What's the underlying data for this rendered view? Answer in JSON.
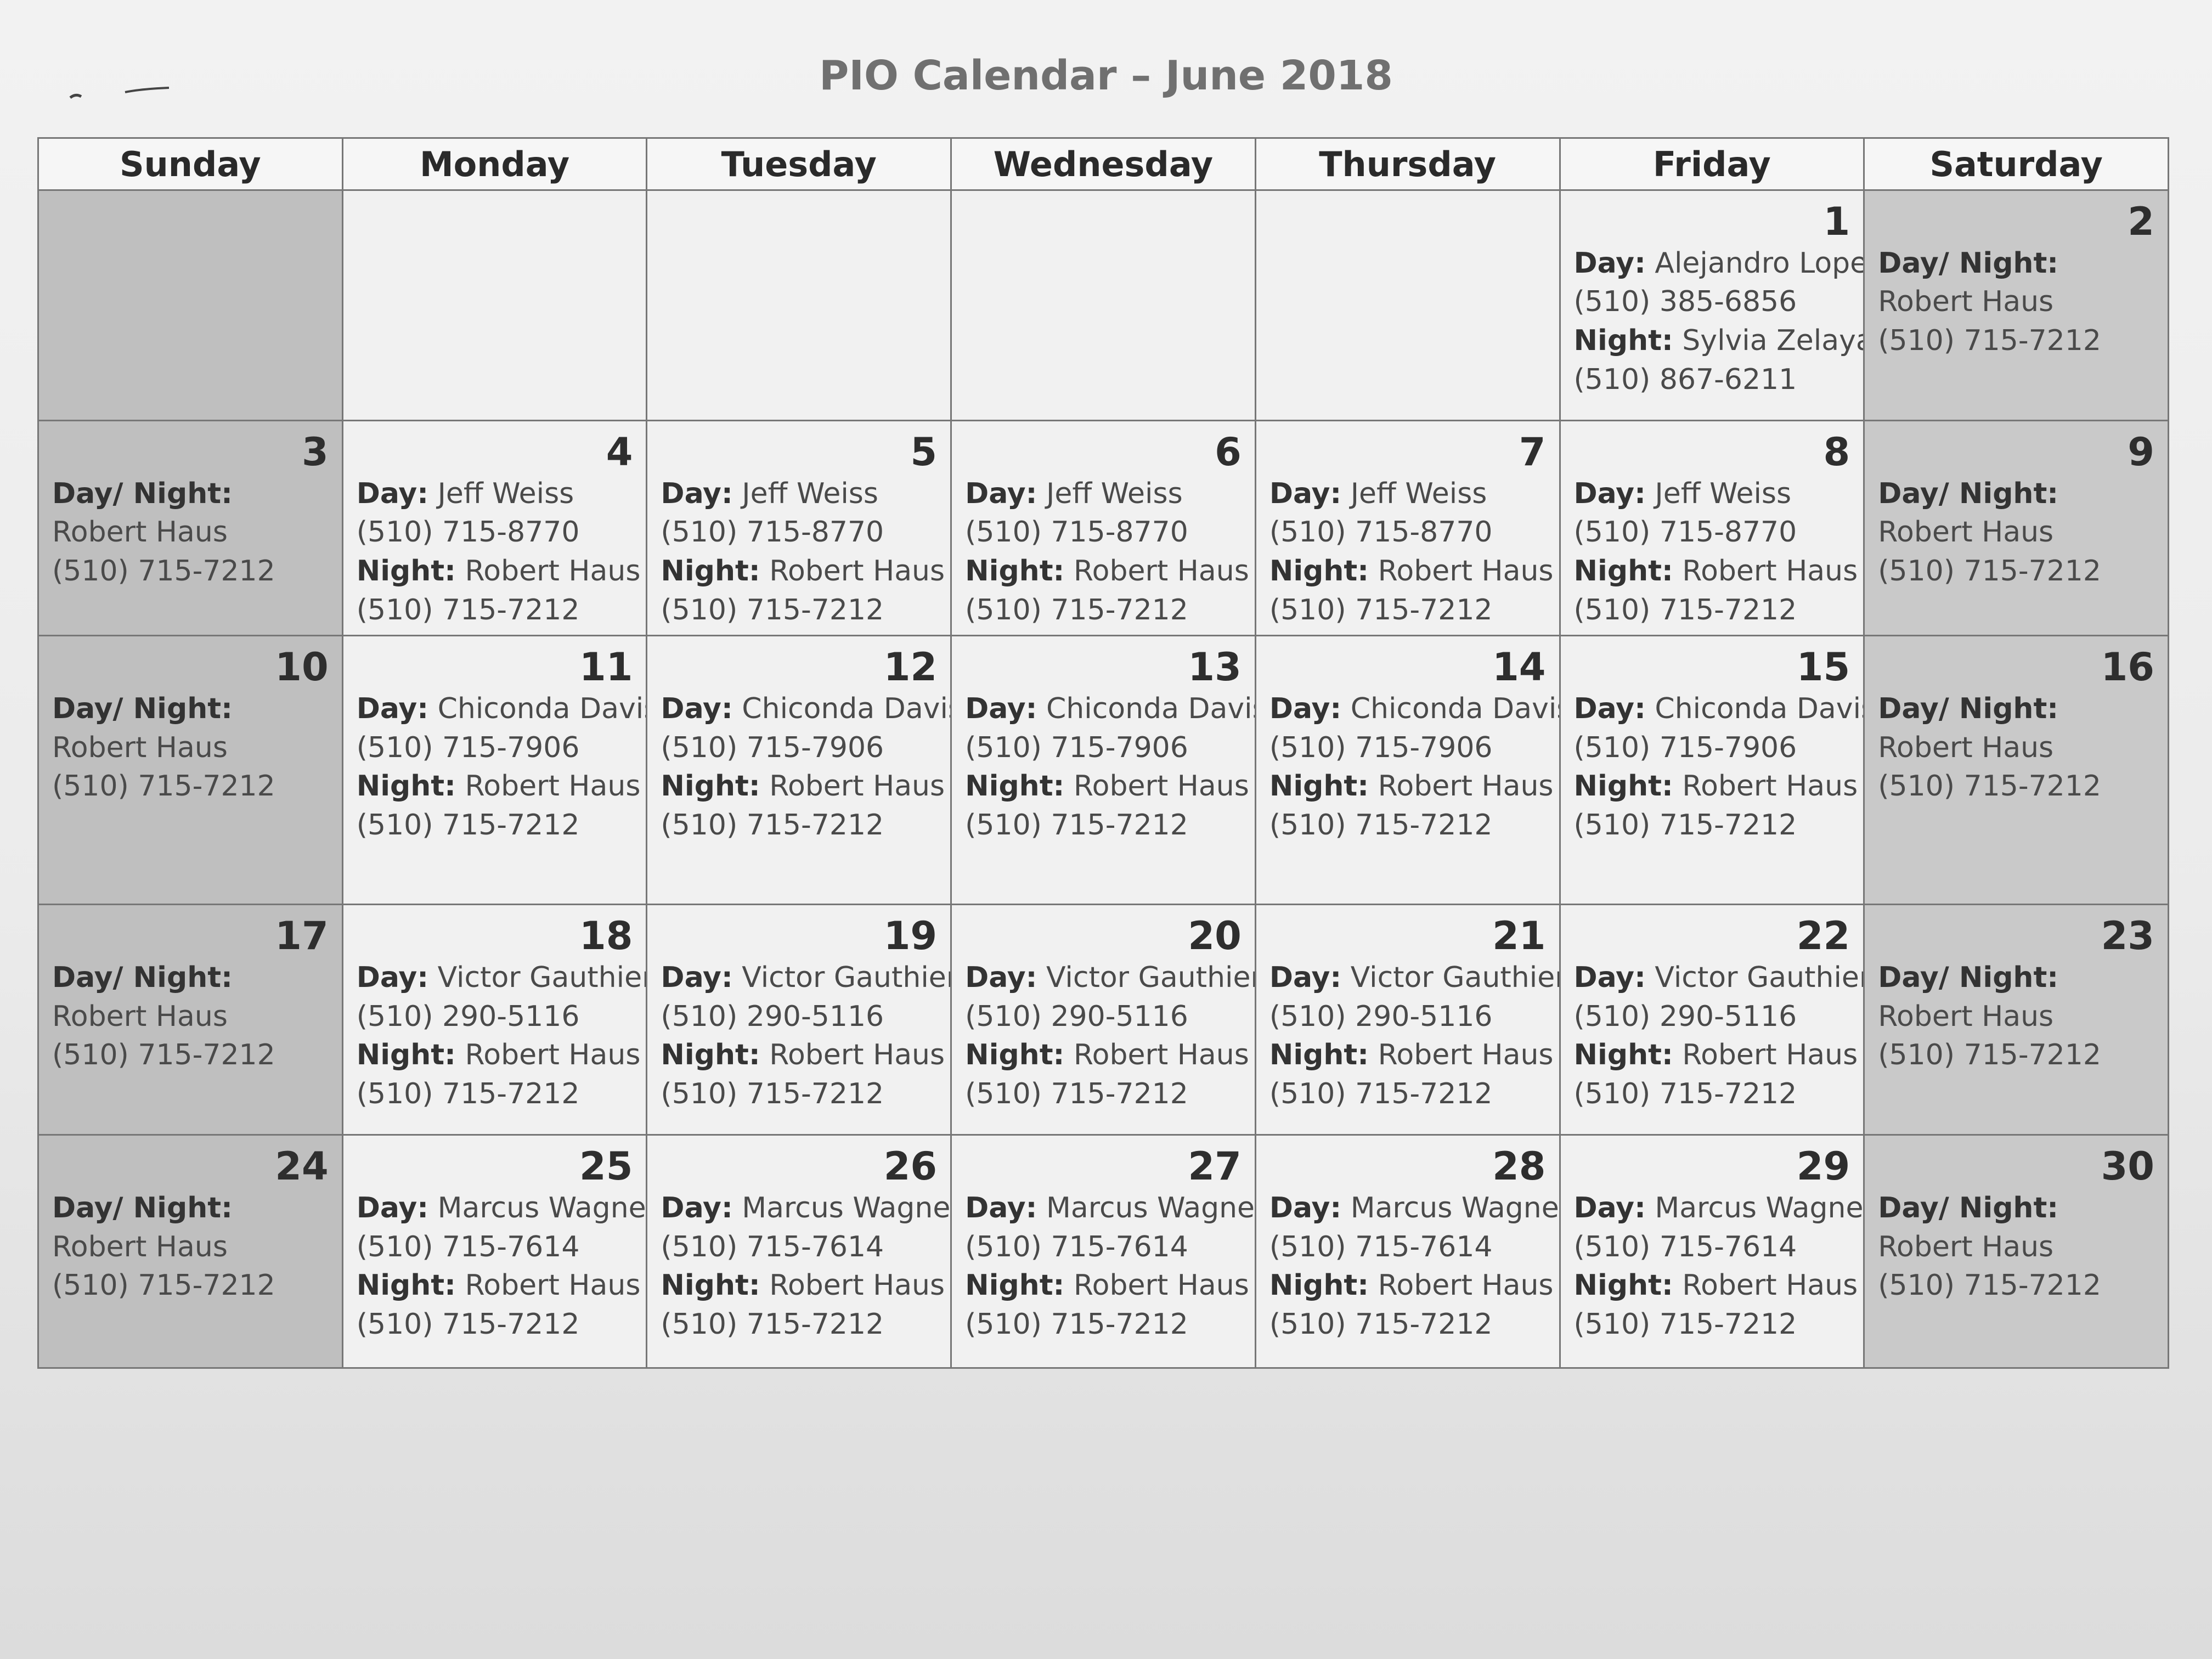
{
  "title": "PIO Calendar – June 2018",
  "weekdays": [
    "Sunday",
    "Monday",
    "Tuesday",
    "Wednesday",
    "Thursday",
    "Friday",
    "Saturday"
  ],
  "labels": {
    "day": "Day:",
    "night": "Night:",
    "daynight": "Day/ Night:"
  },
  "weeks": [
    [
      {
        "date": "",
        "type": "blank"
      },
      {
        "date": "",
        "type": "blank"
      },
      {
        "date": "",
        "type": "blank"
      },
      {
        "date": "",
        "type": "blank"
      },
      {
        "date": "",
        "type": "blank"
      },
      {
        "date": "1",
        "type": "split",
        "day_name": "Alejandro Lopez",
        "day_phone": "(510) 385-6856",
        "night_name": "Sylvia Zelaya",
        "night_phone": "(510) 867-6211"
      },
      {
        "date": "2",
        "type": "combined",
        "name": "Robert Haus",
        "phone": "(510) 715-7212"
      }
    ],
    [
      {
        "date": "3",
        "type": "combined",
        "name": "Robert Haus",
        "phone": "(510) 715-7212"
      },
      {
        "date": "4",
        "type": "split",
        "day_name": "Jeff Weiss",
        "day_phone": "(510) 715-8770",
        "night_name": "Robert Haus",
        "night_phone": "(510) 715-7212"
      },
      {
        "date": "5",
        "type": "split",
        "day_name": "Jeff Weiss",
        "day_phone": "(510) 715-8770",
        "night_name": "Robert Haus",
        "night_phone": "(510) 715-7212"
      },
      {
        "date": "6",
        "type": "split",
        "day_name": "Jeff Weiss",
        "day_phone": "(510) 715-8770",
        "night_name": "Robert Haus",
        "night_phone": "(510) 715-7212"
      },
      {
        "date": "7",
        "type": "split",
        "day_name": "Jeff Weiss",
        "day_phone": "(510) 715-8770",
        "night_name": "Robert Haus",
        "night_phone": "(510) 715-7212"
      },
      {
        "date": "8",
        "type": "split",
        "day_name": "Jeff Weiss",
        "day_phone": "(510) 715-8770",
        "night_name": "Robert Haus",
        "night_phone": "(510) 715-7212"
      },
      {
        "date": "9",
        "type": "combined",
        "name": "Robert Haus",
        "phone": "(510) 715-7212"
      }
    ],
    [
      {
        "date": "10",
        "type": "combined",
        "name": "Robert Haus",
        "phone": "(510) 715-7212"
      },
      {
        "date": "11",
        "type": "split",
        "day_name": "Chiconda Davis",
        "day_phone": "(510) 715-7906",
        "night_name": "Robert Haus",
        "night_phone": "(510) 715-7212"
      },
      {
        "date": "12",
        "type": "split",
        "day_name": "Chiconda Davis",
        "day_phone": "(510) 715-7906",
        "night_name": "Robert Haus",
        "night_phone": "(510) 715-7212"
      },
      {
        "date": "13",
        "type": "split",
        "day_name": "Chiconda Davis",
        "day_phone": "(510) 715-7906",
        "night_name": "Robert Haus",
        "night_phone": "(510) 715-7212"
      },
      {
        "date": "14",
        "type": "split",
        "day_name": "Chiconda Davis",
        "day_phone": "(510) 715-7906",
        "night_name": "Robert Haus",
        "night_phone": "(510) 715-7212"
      },
      {
        "date": "15",
        "type": "split",
        "day_name": "Chiconda Davis",
        "day_phone": "(510) 715-7906",
        "night_name": "Robert Haus",
        "night_phone": "(510) 715-7212"
      },
      {
        "date": "16",
        "type": "combined",
        "name": "Robert Haus",
        "phone": "(510) 715-7212"
      }
    ],
    [
      {
        "date": "17",
        "type": "combined",
        "name": "Robert Haus",
        "phone": "(510) 715-7212"
      },
      {
        "date": "18",
        "type": "split",
        "day_name": "Victor Gauthier",
        "day_phone": "(510) 290-5116",
        "night_name": "Robert Haus",
        "night_phone": "(510) 715-7212"
      },
      {
        "date": "19",
        "type": "split",
        "day_name": "Victor Gauthier",
        "day_phone": "(510) 290-5116",
        "night_name": "Robert Haus",
        "night_phone": "(510) 715-7212"
      },
      {
        "date": "20",
        "type": "split",
        "day_name": "Victor Gauthier",
        "day_phone": "(510) 290-5116",
        "night_name": "Robert Haus",
        "night_phone": "(510) 715-7212"
      },
      {
        "date": "21",
        "type": "split",
        "day_name": "Victor Gauthier",
        "day_phone": "(510) 290-5116",
        "night_name": "Robert Haus",
        "night_phone": "(510) 715-7212"
      },
      {
        "date": "22",
        "type": "split",
        "day_name": "Victor Gauthier",
        "day_phone": "(510) 290-5116",
        "night_name": "Robert Haus",
        "night_phone": "(510) 715-7212"
      },
      {
        "date": "23",
        "type": "combined",
        "name": "Robert Haus",
        "phone": "(510) 715-7212"
      }
    ],
    [
      {
        "date": "24",
        "type": "combined",
        "name": "Robert Haus",
        "phone": "(510) 715-7212"
      },
      {
        "date": "25",
        "type": "split",
        "day_name": "Marcus Wagner",
        "day_phone": "(510) 715-7614",
        "night_name": "Robert Haus",
        "night_phone": "(510) 715-7212"
      },
      {
        "date": "26",
        "type": "split",
        "day_name": "Marcus Wagner",
        "day_phone": "(510) 715-7614",
        "night_name": "Robert Haus",
        "night_phone": "(510) 715-7212"
      },
      {
        "date": "27",
        "type": "split",
        "day_name": "Marcus Wagner",
        "day_phone": "(510) 715-7614",
        "night_name": "Robert Haus",
        "night_phone": "(510) 715-7212"
      },
      {
        "date": "28",
        "type": "split",
        "day_name": "Marcus Wagner",
        "day_phone": "(510) 715-7614",
        "night_name": "Robert Haus",
        "night_phone": "(510) 715-7212"
      },
      {
        "date": "29",
        "type": "split",
        "day_name": "Marcus Wagner",
        "day_phone": "(510) 715-7614",
        "night_name": "Robert Haus",
        "night_phone": "(510) 715-7212"
      },
      {
        "date": "30",
        "type": "combined",
        "name": "Robert Haus",
        "phone": "(510) 715-7212"
      }
    ]
  ]
}
